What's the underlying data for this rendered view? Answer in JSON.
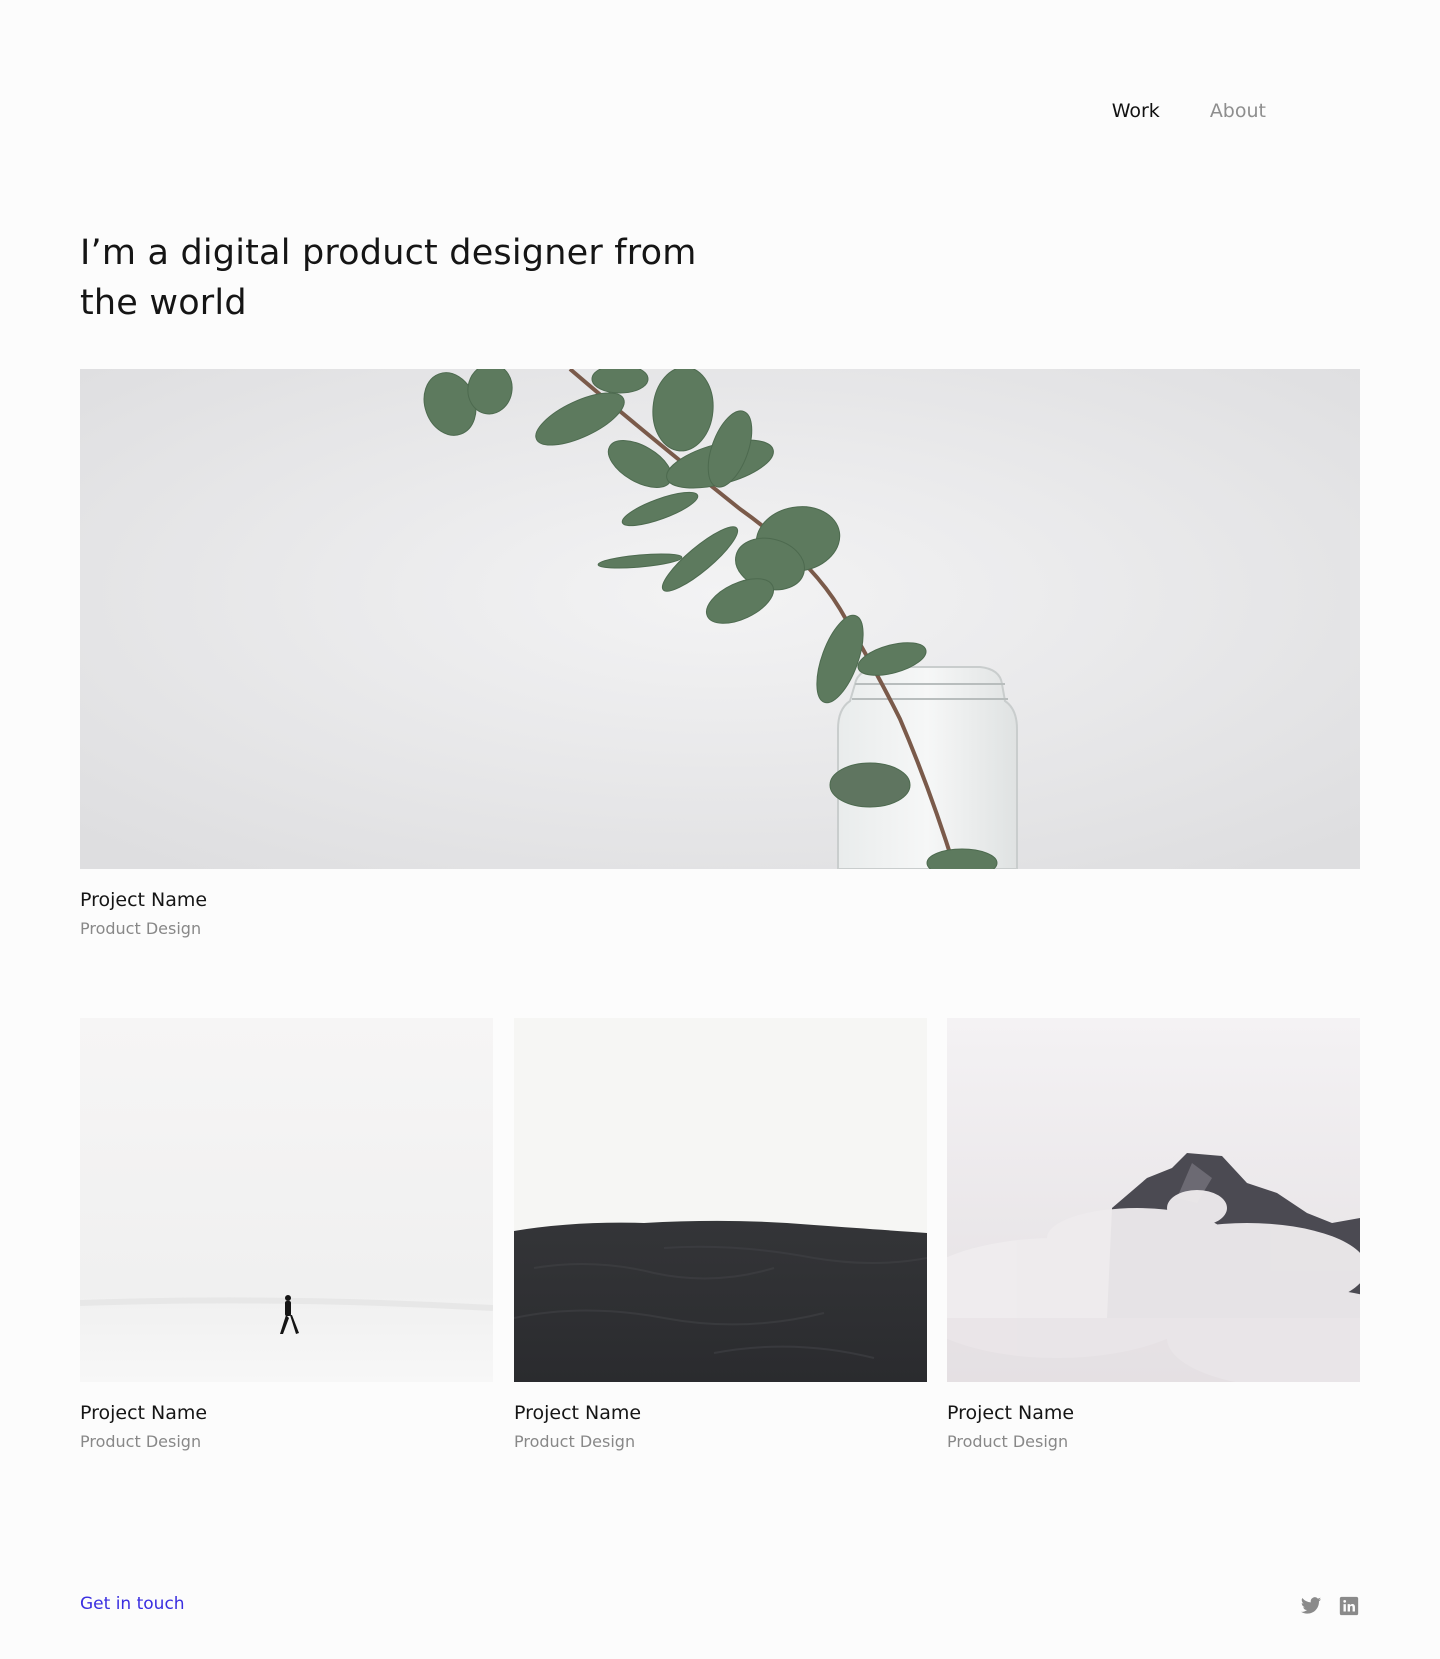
{
  "nav": {
    "items": [
      {
        "label": "Work",
        "active": true
      },
      {
        "label": "About",
        "active": false
      }
    ]
  },
  "hero": {
    "title": "I’m a digital product designer from the world"
  },
  "projects": [
    {
      "name": "Project Name",
      "category": "Product Design",
      "image": "eucalyptus-branch-in-glass-jar"
    },
    {
      "name": "Project Name",
      "category": "Product Design",
      "image": "person-walking-in-snow"
    },
    {
      "name": "Project Name",
      "category": "Product Design",
      "image": "dark-sand-dune"
    },
    {
      "name": "Project Name",
      "category": "Product Design",
      "image": "mountain-in-clouds"
    }
  ],
  "footer": {
    "contact_label": "Get in touch",
    "socials": [
      "twitter-icon",
      "linkedin-icon"
    ]
  },
  "colors": {
    "background": "#fcfcfc",
    "text": "#151515",
    "muted": "#888888",
    "link": "#3a2ee0"
  }
}
